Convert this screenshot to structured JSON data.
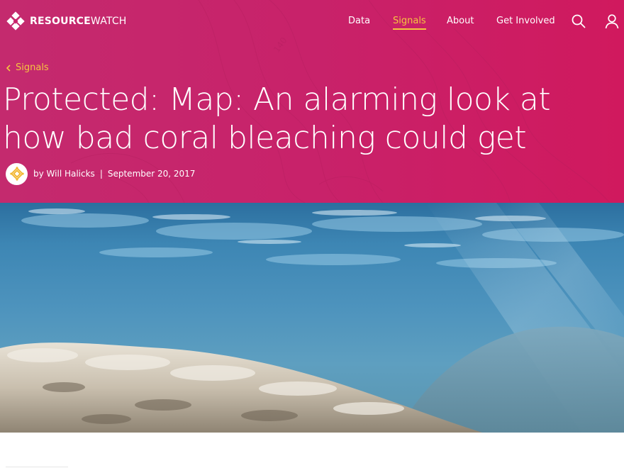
{
  "header": {
    "logo_bold": "RESOURCE",
    "logo_light": "WATCH",
    "nav": [
      {
        "label": "Data",
        "active": false
      },
      {
        "label": "Signals",
        "active": true
      },
      {
        "label": "About",
        "active": false
      },
      {
        "label": "Get Involved",
        "active": false
      }
    ],
    "icons": {
      "search": "search-icon",
      "user": "user-icon"
    }
  },
  "breadcrumb": {
    "label": "Signals"
  },
  "article": {
    "title": "Protected: Map: An alarming look at how bad coral bleaching could get",
    "author_prefix": "by",
    "author": "Will Halicks",
    "separator": "|",
    "date": "September 20, 2017",
    "hero_image": "underwater-coral-bleaching-photo"
  },
  "colors": {
    "hero_background": "#c8226a",
    "accent": "#f5c540",
    "text_on_hero": "#ffffff"
  }
}
